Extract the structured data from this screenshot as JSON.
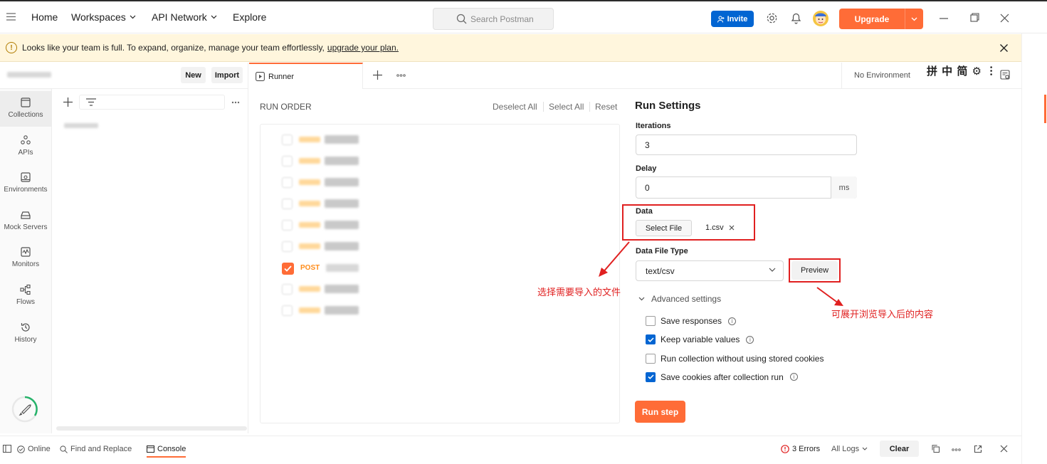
{
  "nav": {
    "home": "Home",
    "workspaces": "Workspaces",
    "api_network": "API Network",
    "explore": "Explore"
  },
  "search": {
    "placeholder": "Search Postman"
  },
  "header": {
    "invite": "Invite",
    "upgrade": "Upgrade"
  },
  "banner": {
    "message": "Looks like your team is full. To expand, organize, manage your team effortlessly,",
    "link": "upgrade your plan."
  },
  "workspace": {
    "new_label": "New",
    "import_label": "Import"
  },
  "rail": [
    {
      "label": "Collections",
      "icon": "collections-icon"
    },
    {
      "label": "APIs",
      "icon": "apis-icon"
    },
    {
      "label": "Environments",
      "icon": "environments-icon"
    },
    {
      "label": "Mock Servers",
      "icon": "mock-servers-icon"
    },
    {
      "label": "Monitors",
      "icon": "monitors-icon"
    },
    {
      "label": "Flows",
      "icon": "flows-icon"
    },
    {
      "label": "History",
      "icon": "history-icon"
    }
  ],
  "tab": {
    "label": "Runner"
  },
  "environment": {
    "label": "No Environment",
    "ime": "拼 中 简 ⚙ ︙"
  },
  "run_order": {
    "title": "RUN ORDER",
    "deselect_all": "Deselect All",
    "select_all": "Select All",
    "reset": "Reset",
    "post_method": "POST"
  },
  "settings": {
    "title": "Run Settings",
    "iterations_label": "Iterations",
    "iterations_value": "3",
    "delay_label": "Delay",
    "delay_value": "0",
    "delay_unit": "ms",
    "data_label": "Data",
    "select_file": "Select File",
    "file_name": "1.csv",
    "data_file_type_label": "Data File Type",
    "data_file_type_value": "text/csv",
    "preview": "Preview",
    "advanced": "Advanced settings",
    "options": [
      {
        "label": "Save responses",
        "checked": false,
        "info": true
      },
      {
        "label": "Keep variable values",
        "checked": true,
        "info": true
      },
      {
        "label": "Run collection without using stored cookies",
        "checked": false,
        "info": false
      },
      {
        "label": "Save cookies after collection run",
        "checked": true,
        "info": true
      }
    ],
    "run_step": "Run step"
  },
  "annotations": {
    "select_file_note": "选择需要导入的文件",
    "preview_note": "可展开浏览导入后的内容",
    "color": "#e02020"
  },
  "bottom": {
    "online": "Online",
    "find_replace": "Find and Replace",
    "console": "Console",
    "errors": "3 Errors",
    "all_logs": "All Logs",
    "clear": "Clear"
  },
  "colors": {
    "accent": "#ff6c37",
    "primary": "#0265d2",
    "banner_bg": "#fff6dd"
  }
}
